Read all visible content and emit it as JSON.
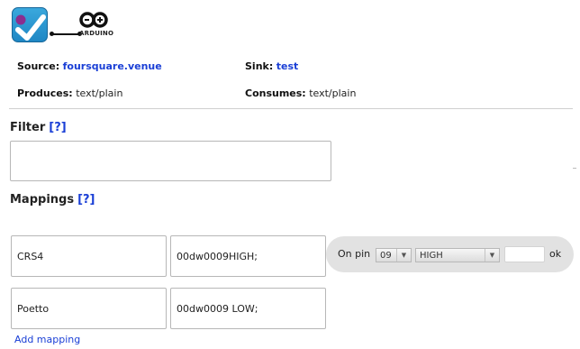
{
  "header": {
    "source_label": "Source:",
    "source_value": "foursquare.venue",
    "sink_label": "Sink:",
    "sink_value": "test",
    "produces_label": "Produces:",
    "produces_value": "text/plain",
    "consumes_label": "Consumes:",
    "consumes_value": "text/plain",
    "arduino_logo_text": "ARDUINO"
  },
  "filter": {
    "title": "Filter",
    "help": "[?]",
    "value": ""
  },
  "mappings": {
    "title": "Mappings",
    "help": "[?]",
    "rows": [
      {
        "key": "CRS4",
        "value": "00dw0009HIGH;"
      },
      {
        "key": "Poetto",
        "value": "00dw0009 LOW;"
      }
    ],
    "pin_editor": {
      "label": "On pin",
      "pin_value": "09",
      "state_value": "HIGH",
      "ok_label": "ok",
      "input_value": ""
    },
    "add_label": "Add mapping"
  },
  "colors": {
    "link": "#1a3fd6",
    "panel": "#e2e2e2",
    "foursquare": "#2b9ad3"
  },
  "icons": {
    "source": "foursquare-check-icon",
    "sink": "arduino-infinity-icon",
    "dropdown": "triangle-down-icon"
  }
}
